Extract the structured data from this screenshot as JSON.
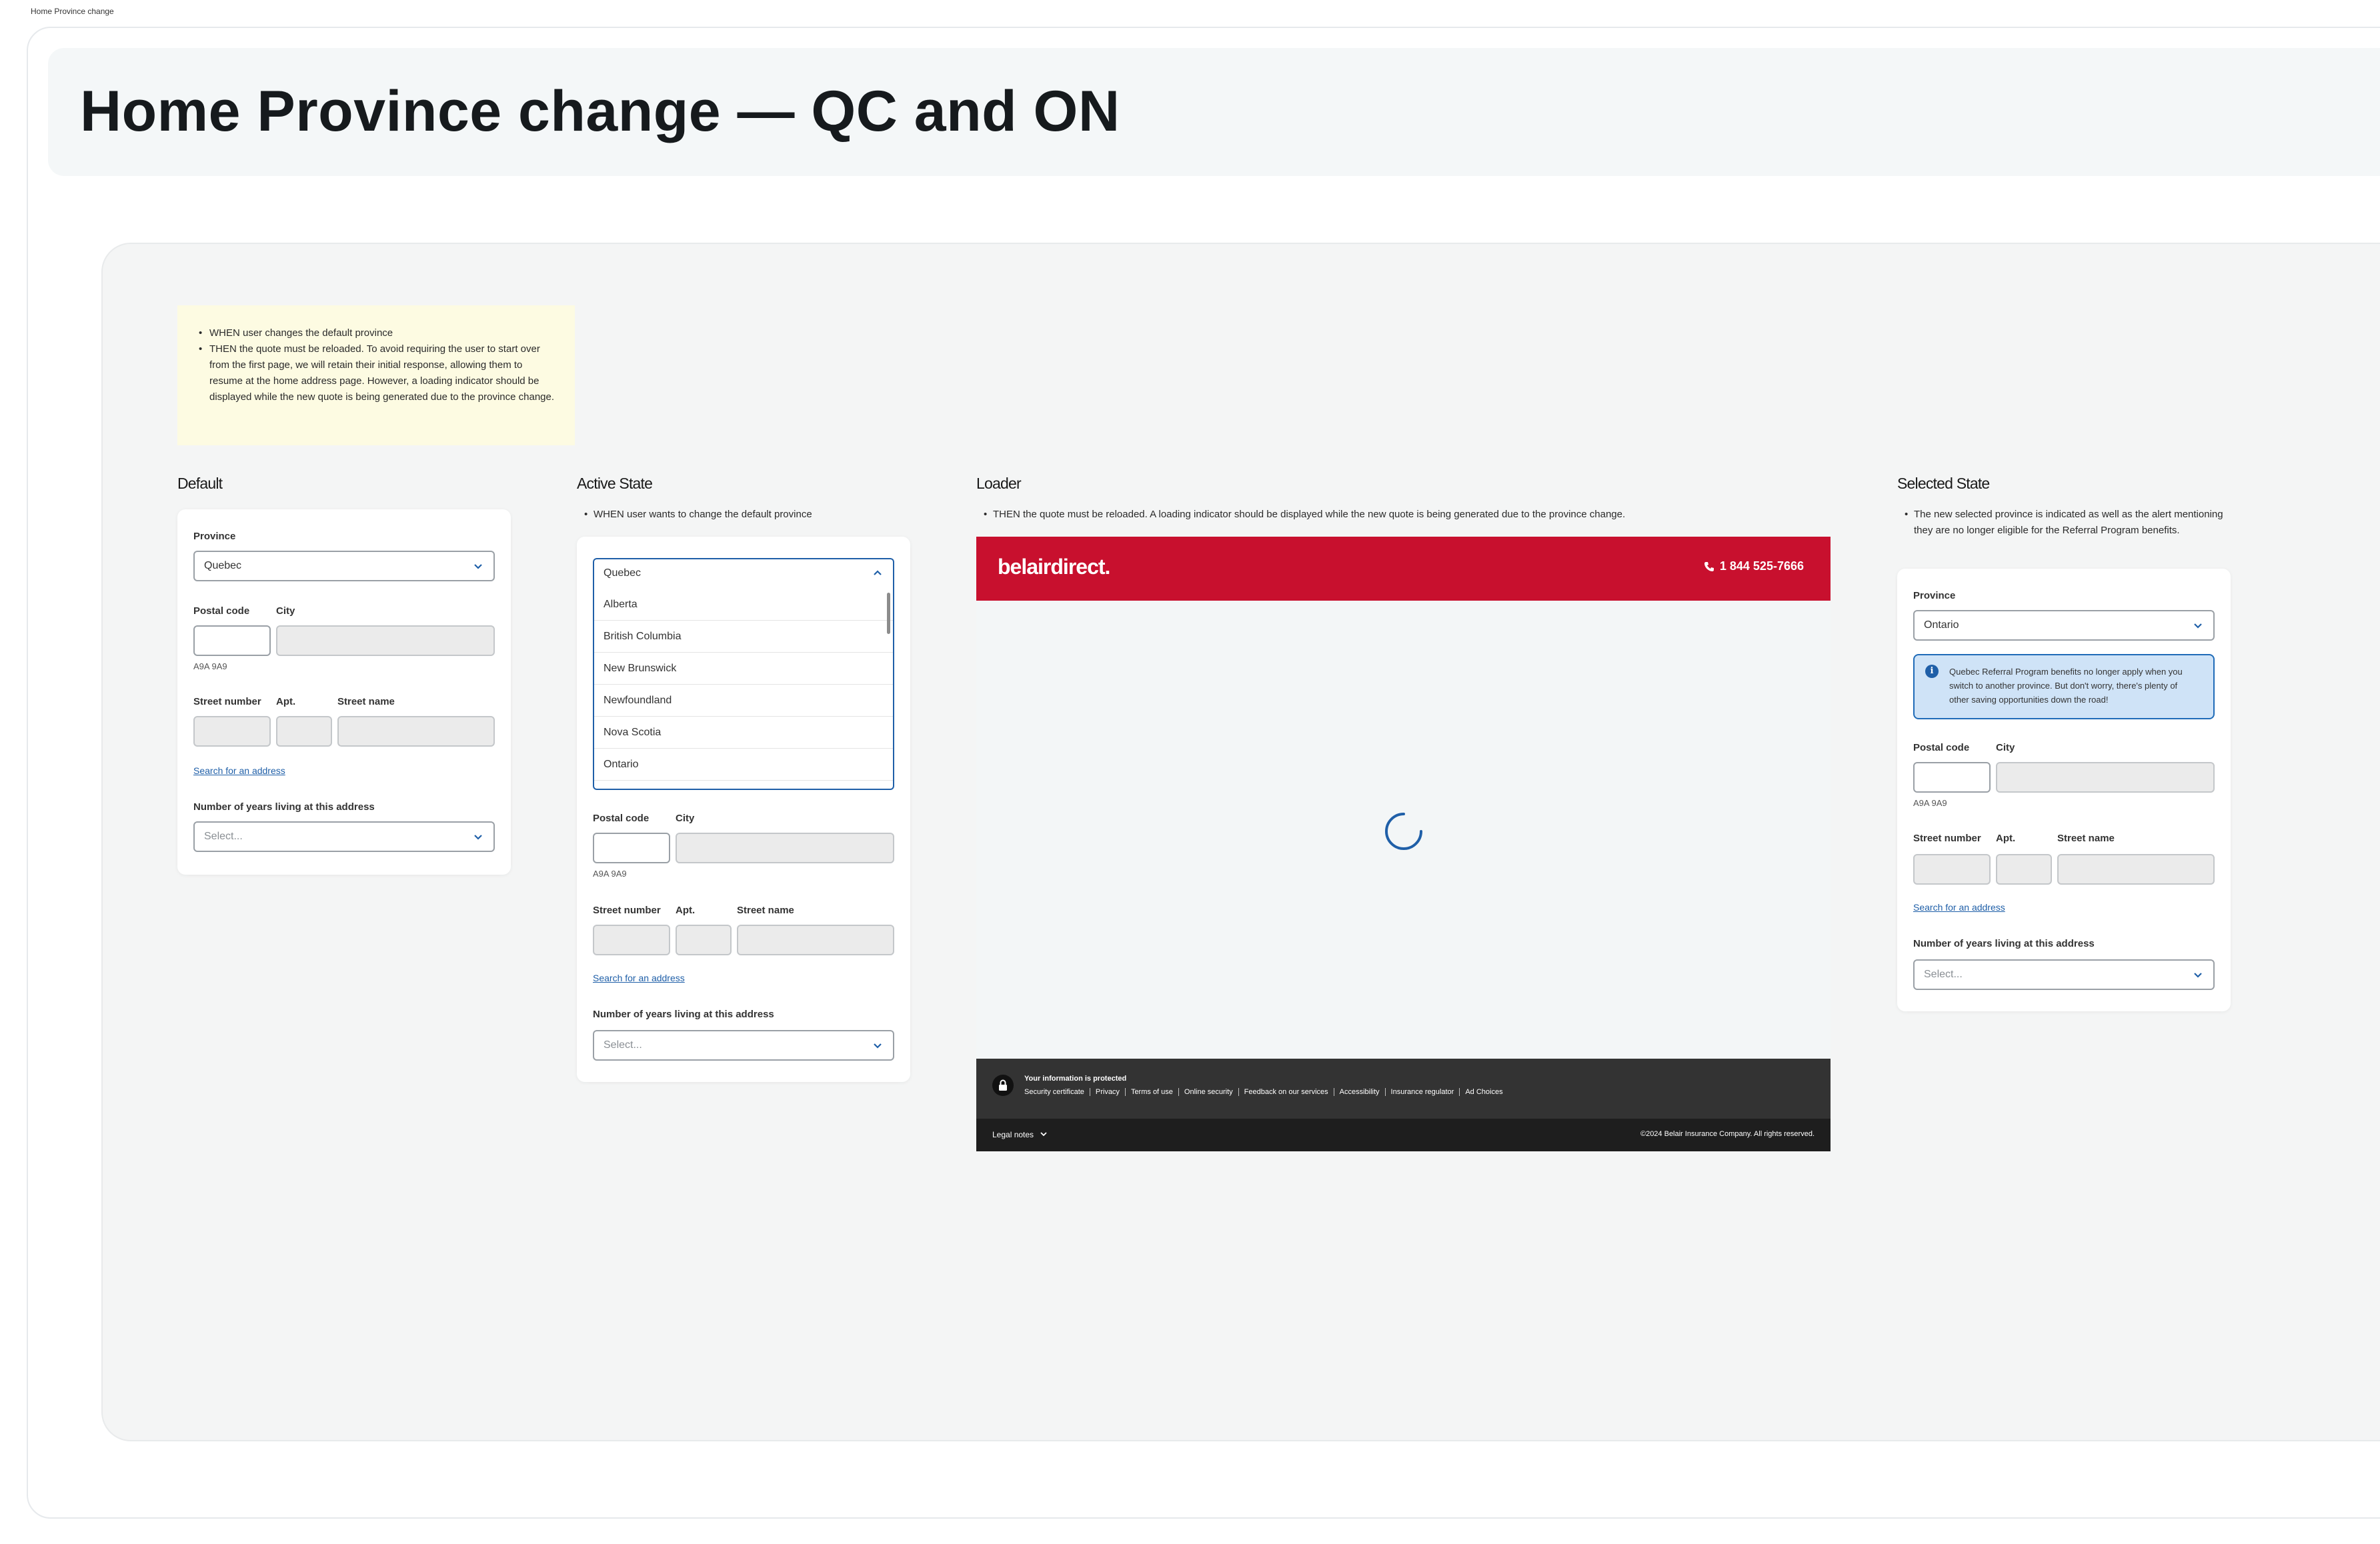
{
  "frame_label": "Home Province change",
  "page_title": "Home Province change — QC and ON",
  "sticky_note": [
    "WHEN user changes the default province",
    "THEN the quote must be reloaded. To avoid requiring the user to start over from the first page, we will retain their initial response, allowing them to resume at the home address page. However, a loading indicator should be displayed while the new quote is being generated due to the province change."
  ],
  "form_labels": {
    "province": "Province",
    "postal_code": "Postal code",
    "city": "City",
    "postal_hint": "A9A 9A9",
    "street_number": "Street number",
    "apt": "Apt.",
    "street_name": "Street name",
    "search_link": "Search for an address",
    "years": "Number of years living at this address",
    "years_placeholder": "Select..."
  },
  "default": {
    "heading": "Default",
    "province_value": "Quebec"
  },
  "active": {
    "heading": "Active State",
    "note": "WHEN user wants to change the default province",
    "province_value": "Quebec",
    "options": [
      "Alberta",
      "British Columbia",
      "New Brunswick",
      "Newfoundland",
      "Nova Scotia",
      "Ontario"
    ]
  },
  "loader": {
    "heading": "Loader",
    "note": "THEN the quote must be reloaded. A loading indicator should be displayed while the new quote is being generated due to the province change.",
    "brand": "belairdirect.",
    "phone": "1 844 525-7666",
    "protected": "Your information is protected",
    "footer_links": [
      "Security certificate",
      "Privacy",
      "Terms of use",
      "Online security",
      "Feedback on our services",
      "Accessibility",
      "Insurance regulator",
      "Ad Choices"
    ],
    "legal_notes": "Legal notes",
    "copyright": "©2024 Belair Insurance Company. All rights reserved.",
    "brand_color": "#c8102e"
  },
  "selected": {
    "heading": "Selected State",
    "note": "The new selected province is indicated as well as the alert mentioning they are no longer eligible for the Referral Program benefits.",
    "province_value": "Ontario",
    "alert": "Quebec Referral Program benefits no longer apply when you switch to another province. But don't worry, there's plenty of other saving opportunities down the road!"
  },
  "colors": {
    "accent": "#1f5fa8",
    "alert_bg": "#cfe3f7",
    "sticky_bg": "#fdfbe2"
  }
}
